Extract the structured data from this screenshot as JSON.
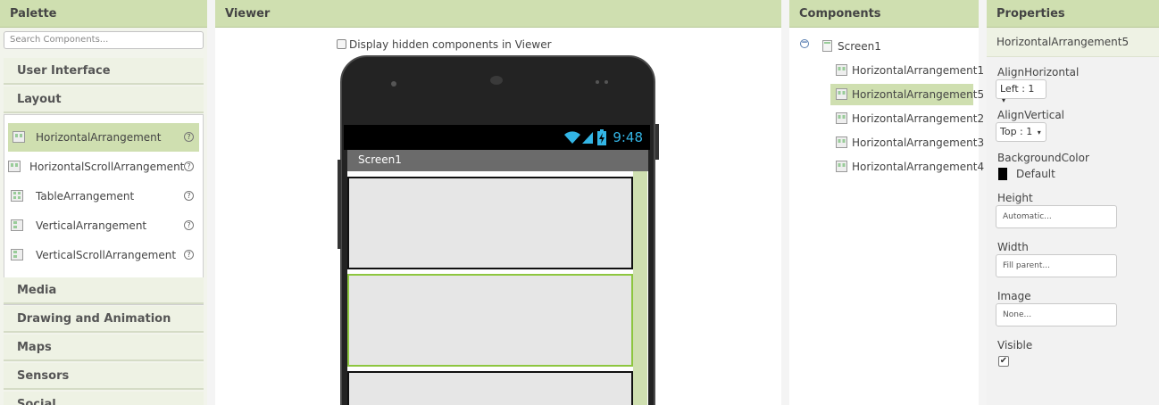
{
  "palette": {
    "title": "Palette",
    "search_placeholder": "Search Components...",
    "categories_top": [
      "User Interface",
      "Layout"
    ],
    "layout_items": [
      {
        "label": "HorizontalArrangement",
        "selected": true
      },
      {
        "label": "HorizontalScrollArrangement",
        "selected": false
      },
      {
        "label": "TableArrangement",
        "selected": false
      },
      {
        "label": "VerticalArrangement",
        "selected": false
      },
      {
        "label": "VerticalScrollArrangement",
        "selected": false
      }
    ],
    "help_glyph": "?",
    "categories_bottom": [
      "Media",
      "Drawing and Animation",
      "Maps",
      "Sensors",
      "Social"
    ]
  },
  "viewer": {
    "title": "Viewer",
    "hidden_toggle_label": "Display hidden components in Viewer",
    "time": "9:48",
    "screen_title": "Screen1"
  },
  "components": {
    "title": "Components",
    "collapse_glyph": "−",
    "root": "Screen1",
    "children": [
      {
        "label": "HorizontalArrangement1",
        "selected": false
      },
      {
        "label": "HorizontalArrangement5",
        "selected": true
      },
      {
        "label": "HorizontalArrangement2",
        "selected": false
      },
      {
        "label": "HorizontalArrangement3",
        "selected": false
      },
      {
        "label": "HorizontalArrangement4",
        "selected": false
      }
    ]
  },
  "properties": {
    "title": "Properties",
    "component_name": "HorizontalArrangement5",
    "align_horizontal": {
      "label": "AlignHorizontal",
      "value": "Left : 1"
    },
    "align_vertical": {
      "label": "AlignVertical",
      "value": "Top : 1"
    },
    "background_color": {
      "label": "BackgroundColor",
      "value": "Default",
      "swatch": "#000000"
    },
    "height": {
      "label": "Height",
      "value": "Automatic..."
    },
    "width": {
      "label": "Width",
      "value": "Fill parent..."
    },
    "image": {
      "label": "Image",
      "value": "None..."
    },
    "visible": {
      "label": "Visible",
      "checked": true
    },
    "dropdown_arrow": "▾",
    "check_glyph": "✔"
  },
  "colors": {
    "header_bg": "#cfdfb0",
    "selection": "#cfdfb0",
    "selected_border": "#8dc63f",
    "android_blue": "#33b5e5"
  }
}
